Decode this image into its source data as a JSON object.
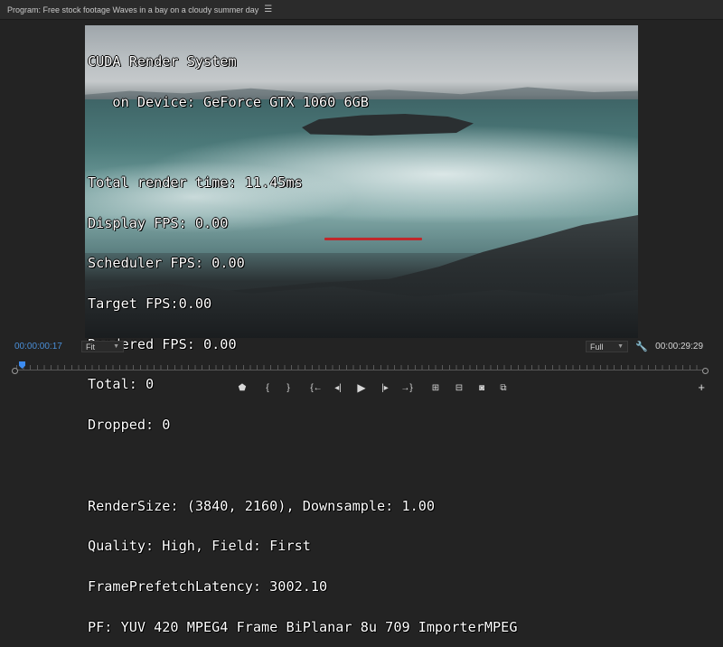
{
  "panel": {
    "title": "Program: Free stock footage Waves in a bay on a cloudy summer day",
    "menu_icon": "hamburger-menu-icon"
  },
  "overlay": {
    "lines": [
      "CUDA Render System",
      "   on Device: GeForce GTX 1060 6GB",
      "",
      "Total render time: 11.45ms",
      "Display FPS: 0.00",
      "Scheduler FPS: 0.00",
      "Target FPS:0.00",
      "Rendered FPS: 0.00",
      "Total: 0",
      "Dropped: 0",
      "",
      "RenderSize: (3840, 2160), Downsample: 1.00",
      "Quality: High, Field: First",
      "FramePrefetchLatency: 3002.10",
      "PF: YUV 420 MPEG4 Frame BiPlanar 8u 709 ImporterMPEG"
    ],
    "highlight_color": "#c0282b"
  },
  "controls": {
    "current_timecode": "00:00:00:17",
    "zoom_value": "Fit",
    "resolution_value": "Full",
    "duration_timecode": "00:00:29:29",
    "timecode_color": "#4a8fd8"
  },
  "transport": {
    "marker_glyph": "⬟",
    "in_point_glyph": "{",
    "out_point_glyph": "}",
    "go_to_in_glyph": "{←",
    "step_back_glyph": "◂|",
    "play_glyph": "▶",
    "step_forward_glyph": "|▸",
    "go_to_out_glyph": "→}",
    "insert_glyph": "⊞",
    "overwrite_glyph": "⊟",
    "export_frame_glyph": "◙",
    "compare_glyph": "⧉",
    "add_glyph": "+"
  }
}
